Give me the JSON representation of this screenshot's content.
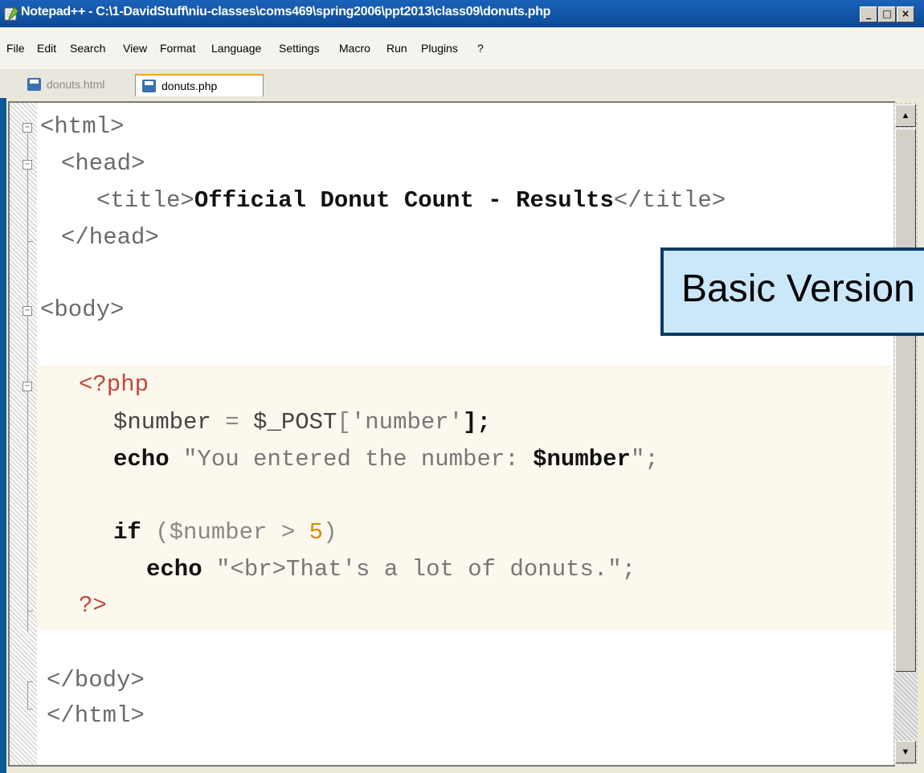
{
  "window": {
    "title": "Notepad++ - C:\\1-DavidStuff\\niu-classes\\coms469\\spring2006\\ppt2013\\class09\\donuts.php",
    "minimize_label": "_",
    "maximize_label": "□",
    "close_label": "×"
  },
  "menu": {
    "items": [
      "File",
      "Edit",
      "Search",
      "View",
      "Format",
      "Language",
      "Settings",
      "Macro",
      "Run",
      "Plugins",
      "?"
    ]
  },
  "tabs": [
    {
      "label": "donuts.html",
      "active": false
    },
    {
      "label": "donuts.php",
      "active": true
    }
  ],
  "code": {
    "l1_tag": "<html>",
    "l2_tag": "<head>",
    "l3_open": "<title>",
    "l3_text": "Official Donut Count - Results",
    "l3_close": "</title>",
    "l4_tag": "</head>",
    "l6_tag": "<body>",
    "l8_php": "<?php",
    "l9_var": "$number",
    "l9_eq": " = ",
    "l9_post": "$_POST",
    "l9_open": "[",
    "l9_key": "'number'",
    "l9_close": "];",
    "l10_echo": "echo",
    "l10_str": " \"You entered the number: ",
    "l10_var": "$number",
    "l10_end": "\";",
    "l12_if": "if",
    "l12_cond": " ($number > ",
    "l12_num": "5",
    "l12_paren": ")",
    "l13_echo": "echo",
    "l13_str": " \"<br>That's a lot of donuts.\";",
    "l14_php": "?>",
    "l16_tag": "</body>",
    "l17_tag": "</html>"
  },
  "callout": {
    "text": "Basic Version"
  },
  "scrollbar": {
    "up_glyph": "▲",
    "down_glyph": "▼"
  },
  "colors": {
    "titlebar": "#1a62b8",
    "callout_bg": "#cbe8fb",
    "callout_border": "#0c3a64",
    "active_tab_accent": "#f7a21b"
  }
}
